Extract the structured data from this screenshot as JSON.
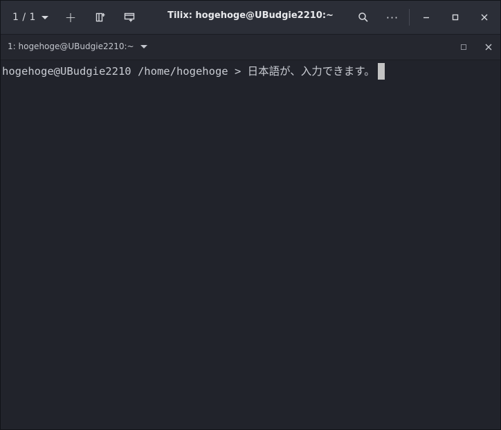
{
  "window": {
    "title": "Tilix: hogehoge@UBudgie2210:~"
  },
  "headerbar": {
    "session_indicator": "1 / 1",
    "add_label": "+",
    "menu_label": "···"
  },
  "terminal_tab": {
    "title": "1: hogehoge@UBudgie2210:~"
  },
  "terminal": {
    "prompt": "hogehoge@UBudgie2210 /home/hogehoge > ",
    "input": "日本語が、入力できます。"
  },
  "icons": {
    "session_caret": "chevron-down-icon",
    "add": "plus-icon",
    "sidebar": "sidebar-icon",
    "split": "split-terminal-icon",
    "search": "search-icon",
    "menu": "more-icon",
    "minimize": "minimize-icon",
    "maximize": "maximize-icon",
    "close": "close-icon",
    "terminal_caret": "chevron-down-icon",
    "terminal_maximize": "maximize-icon",
    "terminal_close": "close-icon"
  },
  "colors": {
    "headerbar_bg": "#2b2e37",
    "terminal_bg": "#21232b",
    "text": "#c9ccd3",
    "cursor": "#c3c3c3"
  }
}
